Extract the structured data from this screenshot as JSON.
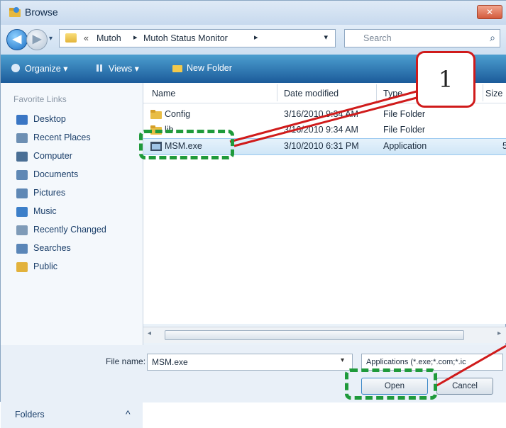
{
  "window": {
    "title": "Browse",
    "close_label": "✕"
  },
  "address": {
    "overflow_chevron": "«",
    "crumbs": [
      "Mutoh",
      "Mutoh Status Monitor"
    ],
    "separator": "▸",
    "search_placeholder": "Search"
  },
  "toolbar": {
    "organize": "Organize ▾",
    "views": "Views ▾",
    "new_folder": "New Folder"
  },
  "callout": {
    "number": "1"
  },
  "sidebar": {
    "heading": "Favorite Links",
    "items": [
      {
        "label": "Desktop",
        "icon": "desktop-icon",
        "color": "#3a76c4"
      },
      {
        "label": "Recent Places",
        "icon": "recent-places-icon",
        "color": "#6d8fb3"
      },
      {
        "label": "Computer",
        "icon": "computer-icon",
        "color": "#4a6f95"
      },
      {
        "label": "Documents",
        "icon": "documents-icon",
        "color": "#5f88b5"
      },
      {
        "label": "Pictures",
        "icon": "pictures-icon",
        "color": "#5f88b5"
      },
      {
        "label": "Music",
        "icon": "music-icon",
        "color": "#3c7fc9"
      },
      {
        "label": "Recently Changed",
        "icon": "recently-changed-icon",
        "color": "#7f9bb8"
      },
      {
        "label": "Searches",
        "icon": "searches-icon",
        "color": "#5a86b8"
      },
      {
        "label": "Public",
        "icon": "public-folder-icon",
        "color": "#e2b23c"
      }
    ],
    "folders_label": "Folders",
    "folders_toggle": "^"
  },
  "list": {
    "columns": [
      "Name",
      "Date modified",
      "Type",
      "Size"
    ],
    "rows": [
      {
        "name": "Config",
        "date": "3/16/2010 9:34 AM",
        "type": "File Folder",
        "size": "",
        "icon": "folder-icon",
        "selected": false
      },
      {
        "name": "lib",
        "date": "3/16/2010 9:34 AM",
        "type": "File Folder",
        "size": "",
        "icon": "folder-icon",
        "selected": false
      },
      {
        "name": "MSM.exe",
        "date": "3/10/2010 6:31 PM",
        "type": "Application",
        "size": "5",
        "icon": "application-icon",
        "selected": true
      }
    ]
  },
  "footer": {
    "file_name_label": "File name:",
    "file_name_value": "MSM.exe",
    "file_type": "Applications (*.exe;*.com;*.ic",
    "open_label": "Open",
    "cancel_label": "Cancel"
  },
  "colors": {
    "highlight": "#1f9a3b",
    "callout_border": "#d01b1b",
    "toolbar": "#2a6ead"
  }
}
